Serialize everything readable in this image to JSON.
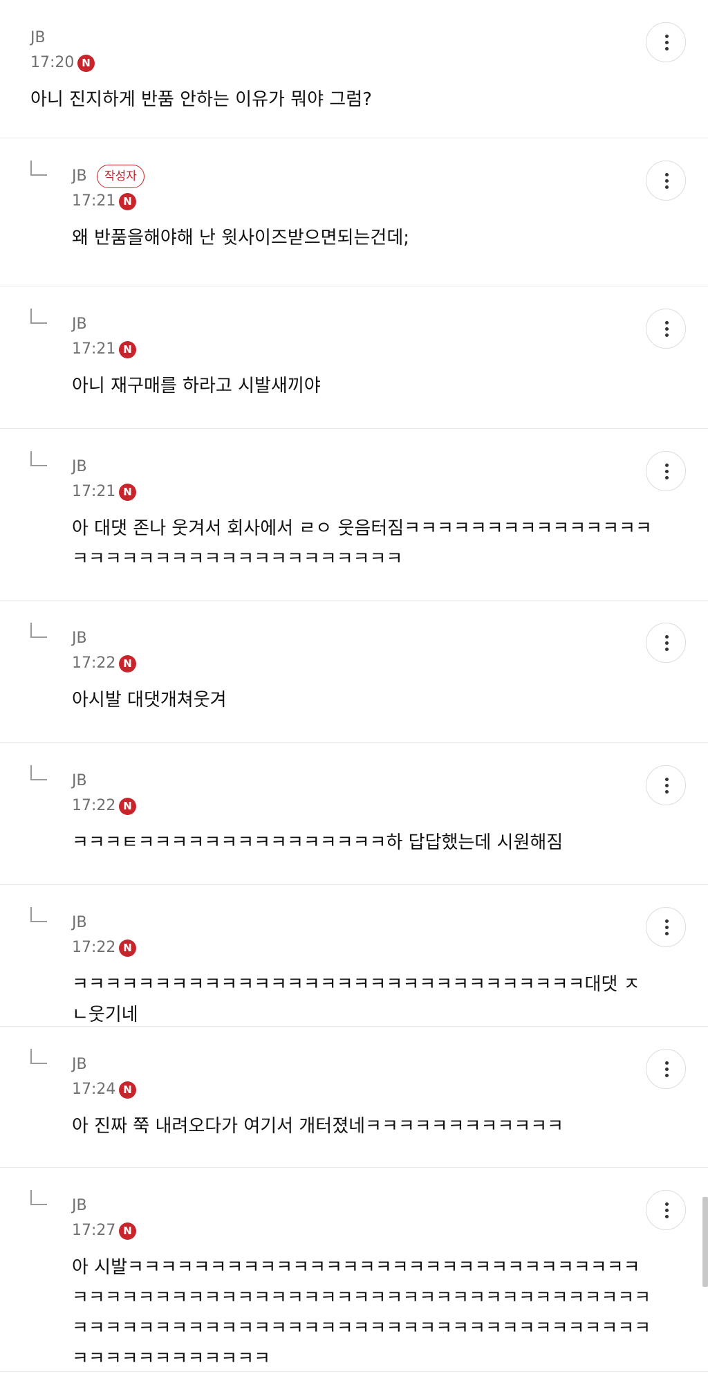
{
  "comments": [
    {
      "author": "JB",
      "time": "17:20",
      "new_icon": "N",
      "text": "아니 진지하게 반품 안하는 이유가 뭐야 그럼?",
      "is_reply": false
    },
    {
      "author": "JB",
      "badge": "작성자",
      "time": "17:21",
      "new_icon": "N",
      "text": "왜 반품을해야해 난 윗사이즈받으면되는건데;",
      "is_reply": true
    },
    {
      "author": "JB",
      "time": "17:21",
      "new_icon": "N",
      "text": "아니 재구매를 하라고 시발새끼야",
      "is_reply": true
    },
    {
      "author": "JB",
      "time": "17:21",
      "new_icon": "N",
      "text": "아 대댓 존나 웃겨서 회사에서 ㄹㅇ 웃음터짐ㅋㅋㅋㅋㅋㅋㅋㅋㅋㅋㅋㅋㅋㅋㅋㅋㅋㅋㅋㅋㅋㅋㅋㅋㅋㅋㅋㅋㅋㅋㅋㅋㅋㅋㅋ",
      "is_reply": true
    },
    {
      "author": "JB",
      "time": "17:22",
      "new_icon": "N",
      "text": "아시발 대댓개쳐웃겨",
      "is_reply": true
    },
    {
      "author": "JB",
      "time": "17:22",
      "new_icon": "N",
      "text": "ㅋㅋㅋㅌㅋㅋㅋㅋㅋㅋㅋㅋㅋㅋㅋㅋㅋㅋㅋ하 답답했는데 시원해짐",
      "is_reply": true
    },
    {
      "author": "JB",
      "time": "17:22",
      "new_icon": "N",
      "text": "ㅋㅋㅋㅋㅋㅋㅋㅋㅋㅋㅋㅋㅋㅋㅋㅋㅋㅋㅋㅋㅋㅋㅋㅋㅋㅋㅋㅋㅋㅋㅋ대댓 ㅈㄴ웃기네",
      "is_reply": true
    },
    {
      "author": "JB",
      "time": "17:24",
      "new_icon": "N",
      "text": "아 진짜 쭉 내려오다가 여기서 개터졌네ㅋㅋㅋㅋㅋㅋㅋㅋㅋㅋㅋㅋ",
      "is_reply": true
    },
    {
      "author": "JB",
      "time": "17:27",
      "new_icon": "N",
      "text": "아 시발ㅋㅋㅋㅋㅋㅋㅋㅋㅋㅋㅋㅋㅋㅋㅋㅋㅋㅋㅋㅋㅋㅋㅋㅋㅋㅋㅋㅋㅋㅋㅋㅋㅋㅋㅋㅋㅋㅋㅋㅋㅋㅋㅋㅋㅋㅋㅋㅋㅋㅋㅋㅋㅋㅋㅋㅋㅋㅋㅋㅋㅋㅋㅋㅋㅋㅋㅋㅋㅋㅋㅋㅋㅋㅋㅋㅋㅋㅋㅋㅋㅋㅋㅋㅋㅋㅋㅋㅋㅋㅋㅋㅋㅋㅋㅋㅋㅋㅋㅋㅋㅋㅋㅋㅋㅋㅋㅋㅋㅋㅋㅋㅋㅋ",
      "is_reply": true
    }
  ],
  "more_icon": "more-vertical-icon",
  "colors": {
    "new_badge": "#c8242b",
    "owner_badge": "#c8242b",
    "meta_text": "#707070",
    "divider": "#e8e8e8"
  }
}
